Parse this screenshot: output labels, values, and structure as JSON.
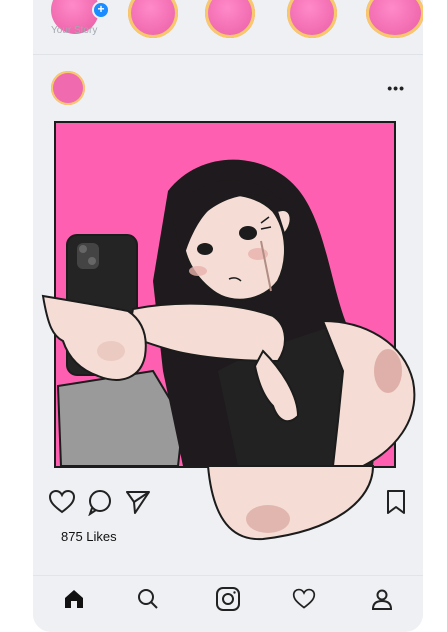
{
  "stories": {
    "your_story_label": "Your Story"
  },
  "post": {
    "likes_text": "875 Likes"
  },
  "icons": {
    "more": "more-options-icon",
    "like": "heart-icon",
    "comment": "comment-icon",
    "share": "send-icon",
    "save": "bookmark-icon",
    "home": "home-icon",
    "search": "search-icon",
    "reels": "camera-icon",
    "activity": "heart-icon",
    "profile": "profile-icon"
  },
  "colors": {
    "accent_pink": "#ff5fb0",
    "badge_blue": "#1a8cff",
    "background": "#eef0f3"
  }
}
